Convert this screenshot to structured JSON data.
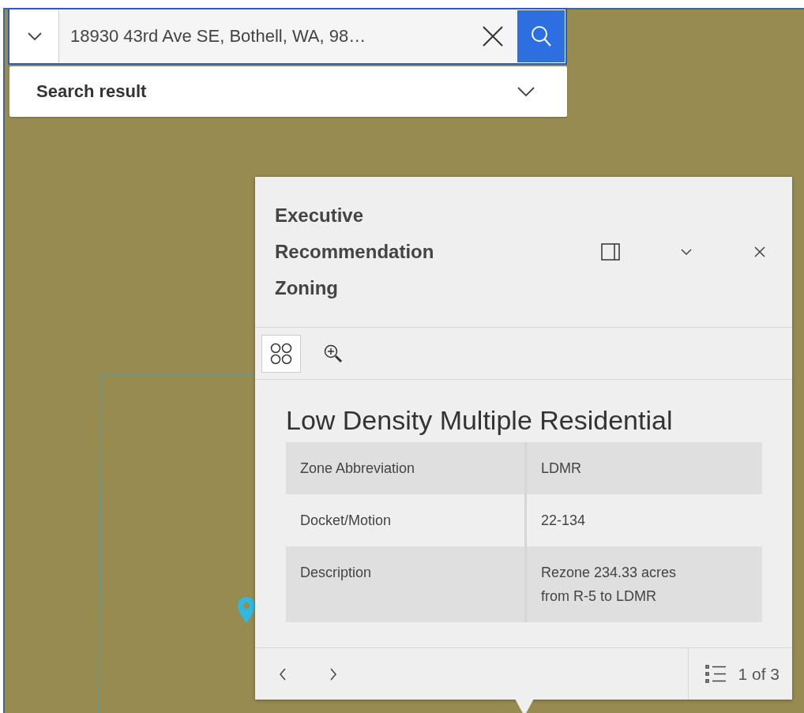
{
  "search": {
    "value": "18930 43rd Ave SE, Bothell, WA, 98…"
  },
  "search_result": {
    "label": "Search result"
  },
  "popup": {
    "title": "Executive Recommendation Zoning",
    "actions": [
      {
        "kind": "select",
        "selected": true
      },
      {
        "kind": "zoom",
        "selected": false
      }
    ],
    "feature_title": "Low Density Multiple Residential",
    "fields": [
      {
        "label": "Zone Abbreviation",
        "value": "LDMR"
      },
      {
        "label": "Docket/Motion",
        "value": "22-134"
      },
      {
        "label": "Description",
        "value": "Rezone 234.33 acres from R-5 to LDMR"
      }
    ],
    "pagination": "1 of 3"
  }
}
